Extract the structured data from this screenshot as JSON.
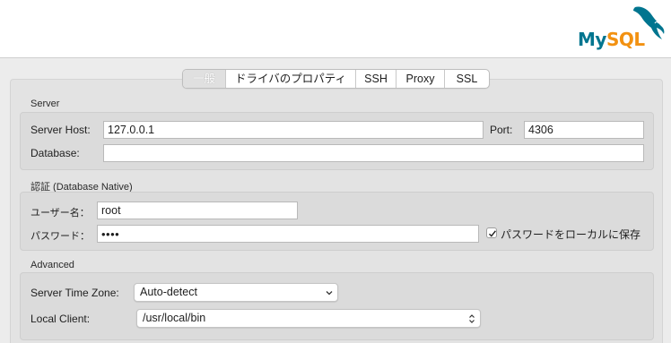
{
  "logo": {
    "text_my": "My",
    "text_sql": "SQL"
  },
  "tabs": [
    {
      "label": "一般",
      "active": true
    },
    {
      "label": "ドライバのプロパティ",
      "active": false
    },
    {
      "label": "SSH",
      "active": false
    },
    {
      "label": "Proxy",
      "active": false
    },
    {
      "label": "SSL",
      "active": false
    }
  ],
  "server": {
    "section_label": "Server",
    "host_label": "Server Host:",
    "host_value": "127.0.0.1",
    "port_label": "Port:",
    "port_value": "4306",
    "database_label": "Database:",
    "database_value": ""
  },
  "auth": {
    "section_label": "認証 (Database Native)",
    "user_label": "ユーザー名：",
    "user_value": "root",
    "password_label": "パスワード：",
    "password_value": "••••",
    "save_local_label": "パスワードをローカルに保存",
    "save_local_checked": true
  },
  "advanced": {
    "section_label": "Advanced",
    "timezone_label": "Server Time Zone:",
    "timezone_value": "Auto-detect",
    "local_client_label": "Local Client:",
    "local_client_value": "/usr/local/bin"
  },
  "colors": {
    "mysql_blue": "#00758f",
    "mysql_orange": "#f29111"
  }
}
